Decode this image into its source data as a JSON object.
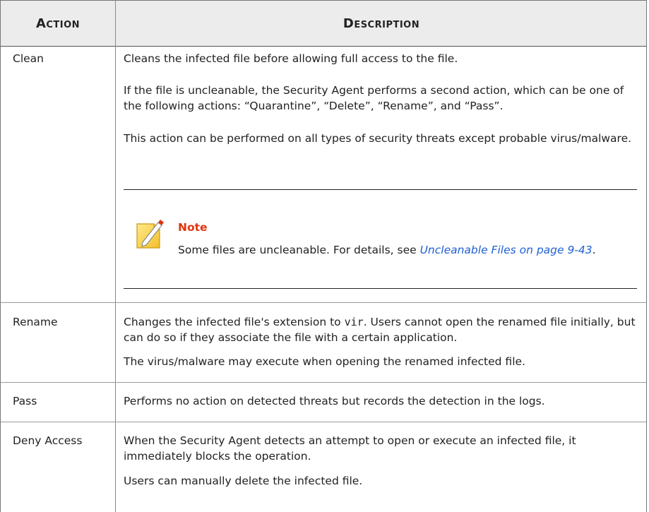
{
  "headers": {
    "action": "Action",
    "description": "Description"
  },
  "rows": [
    {
      "action": "Clean",
      "paragraphs": [
        "Cleans the infected file before allowing full access to the file.",
        "If the file is uncleanable, the Security Agent performs a second action, which can be one of the following actions: “Quarantine”, “Delete”, “Rename”, and “Pass”.",
        "This action can be performed on all types of security threats except probable virus/malware."
      ],
      "note": {
        "icon": "note-pencil-icon",
        "title": "Note",
        "text_before": "Some files are uncleanable. For details, see ",
        "link_text": "Uncleanable Files on page 9-43",
        "text_after": "."
      }
    },
    {
      "action": "Rename",
      "p1_before": "Changes the infected file's extension to ",
      "p1_code": "vir",
      "p1_after": ". Users cannot open the renamed file initially, but can do so if they associate the file with a certain application.",
      "p2": "The virus/malware may execute when opening the renamed infected file."
    },
    {
      "action": "Pass",
      "p1": "Performs no action on detected threats but records the detection in the logs."
    },
    {
      "action": "Deny Access",
      "p1": "When the Security Agent detects an attempt to open or execute an infected file, it immediately blocks the operation.",
      "p2": "Users can manually delete the infected file."
    }
  ]
}
